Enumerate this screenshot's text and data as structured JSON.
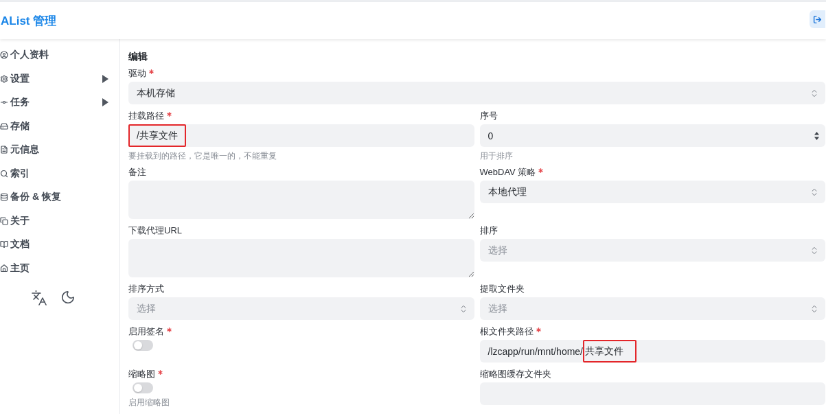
{
  "header": {
    "title": "AList 管理"
  },
  "sidebar": {
    "items": [
      {
        "label": "个人资料",
        "kind": "link"
      },
      {
        "label": "设置",
        "kind": "group"
      },
      {
        "label": "任务",
        "kind": "group"
      },
      {
        "label": "存储",
        "kind": "link"
      },
      {
        "label": "元信息",
        "kind": "link"
      },
      {
        "label": "索引",
        "kind": "link"
      },
      {
        "label": "备份 & 恢复",
        "kind": "link"
      },
      {
        "label": "关于",
        "kind": "link"
      },
      {
        "label": "文档",
        "kind": "link"
      },
      {
        "label": "主页",
        "kind": "link"
      }
    ]
  },
  "form": {
    "title": "编辑",
    "driver": {
      "label": "驱动",
      "required": true,
      "kind": "select",
      "value": "本机存储"
    },
    "fields": [
      {
        "label": "挂载路径",
        "required": true,
        "kind": "text",
        "value_parts": [
          {
            "text": "/共享文件",
            "marked": true
          }
        ],
        "hint": "要挂载到的路径，它是唯一的，不能重复"
      },
      {
        "label": "序号",
        "required": false,
        "kind": "number",
        "value": "0",
        "hint": "用于排序"
      },
      {
        "label": "备注",
        "required": false,
        "kind": "textarea"
      },
      {
        "label": "WebDAV 策略",
        "required": true,
        "kind": "select",
        "value": "本地代理"
      },
      {
        "label": "下载代理URL",
        "required": false,
        "kind": "textarea"
      },
      {
        "label": "排序",
        "required": false,
        "kind": "select",
        "placeholder": "选择"
      },
      {
        "label": "排序方式",
        "required": false,
        "kind": "select",
        "placeholder": "选择"
      },
      {
        "label": "提取文件夹",
        "required": false,
        "kind": "select",
        "placeholder": "选择"
      },
      {
        "label": "启用签名",
        "required": true,
        "kind": "switch",
        "on": false
      },
      {
        "label": "根文件夹路径",
        "required": true,
        "kind": "text",
        "value_parts": [
          {
            "text": "/lzcapp/run/mnt/home/",
            "marked": false
          },
          {
            "text": "共享文件",
            "marked": true
          }
        ]
      },
      {
        "label": "缩略图",
        "required": true,
        "kind": "switch",
        "on": false,
        "hint": "启用缩略图"
      },
      {
        "label": "缩略图缓存文件夹",
        "required": false,
        "kind": "text"
      }
    ]
  }
}
